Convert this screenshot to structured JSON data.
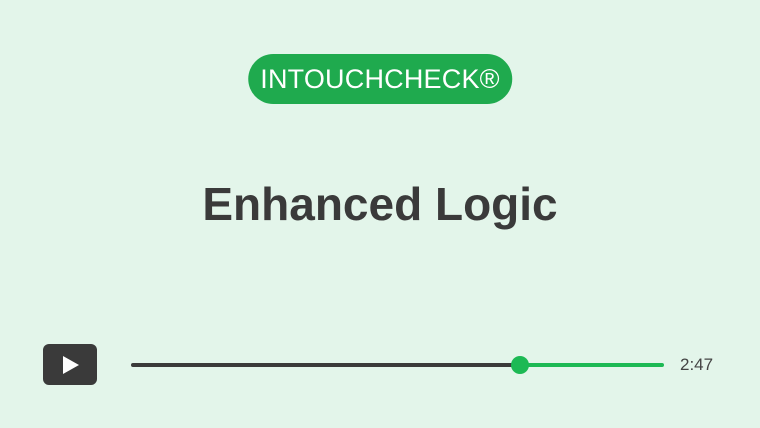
{
  "badge": {
    "text": "INTOUCHCHECK®"
  },
  "title": "Enhanced Logic",
  "player": {
    "progress_fraction": 0.73,
    "duration": "2:47",
    "play_icon": "play-icon"
  },
  "colors": {
    "background": "#e3f5ea",
    "accent": "#1db954",
    "badge_bg": "#1faa4e",
    "title_text": "#3a3a3a",
    "played_track": "#3a3a3a",
    "play_button_bg": "#3a3a3a"
  }
}
